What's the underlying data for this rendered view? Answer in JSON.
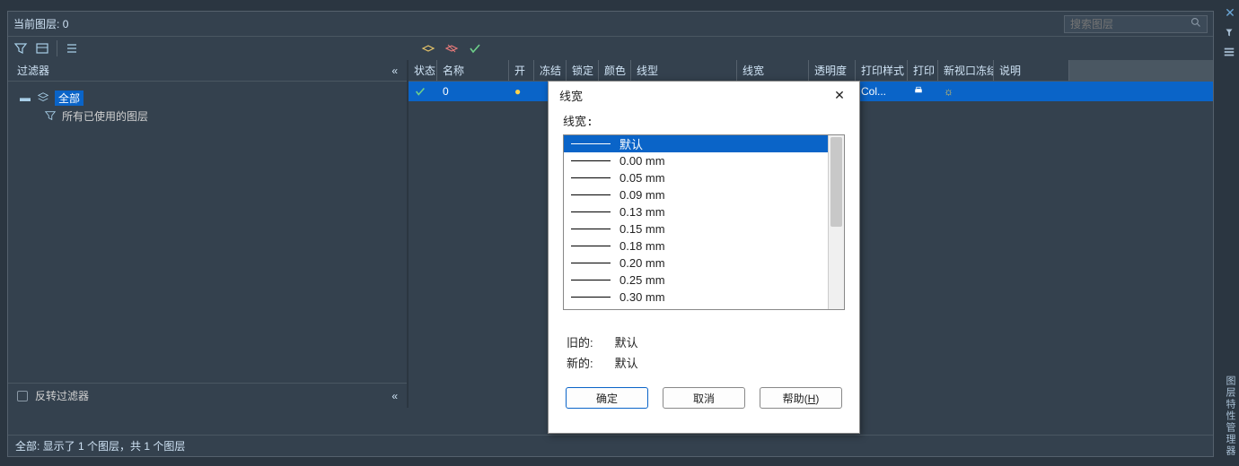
{
  "top": {
    "current_layer_label": "当前图层:",
    "current_layer_value": "0",
    "search_placeholder": "搜索图层"
  },
  "left": {
    "header": "过滤器",
    "root_label": "全部",
    "child_label": "所有已使用的图层",
    "invert_label": "反转过滤器"
  },
  "grid": {
    "headers": [
      "状态",
      "名称",
      "开",
      "冻结",
      "锁定",
      "颜色",
      "线型",
      "线宽",
      "透明度",
      "打印样式",
      "打印",
      "新视口冻结",
      "说明"
    ],
    "row": {
      "name": "0",
      "print_style": "Col..."
    }
  },
  "status": "全部: 显示了 1 个图层，共 1 个图层",
  "right_strip": {
    "text": "图层特性管理器"
  },
  "dialog": {
    "title": "线宽",
    "list_label": "线宽:",
    "items": [
      {
        "label": "默认",
        "w": 1,
        "selected": true
      },
      {
        "label": "0.00 mm",
        "w": 1
      },
      {
        "label": "0.05 mm",
        "w": 1
      },
      {
        "label": "0.09 mm",
        "w": 1
      },
      {
        "label": "0.13 mm",
        "w": 1
      },
      {
        "label": "0.15 mm",
        "w": 1
      },
      {
        "label": "0.18 mm",
        "w": 1
      },
      {
        "label": "0.20 mm",
        "w": 1
      },
      {
        "label": "0.25 mm",
        "w": 1
      },
      {
        "label": "0.30 mm",
        "w": 1
      }
    ],
    "old_label": "旧的:",
    "old_value": "默认",
    "new_label": "新的:",
    "new_value": "默认",
    "buttons": {
      "ok": "确定",
      "cancel": "取消",
      "help": "帮助(H)"
    },
    "help_key": "H"
  }
}
